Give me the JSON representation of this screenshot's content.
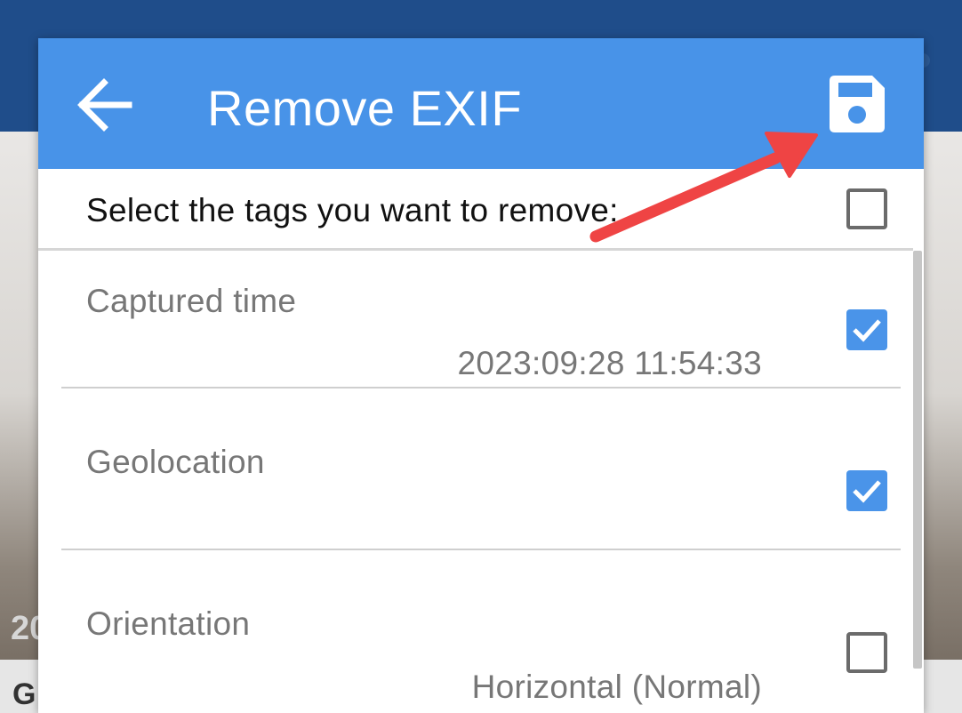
{
  "background": {
    "year_fragment": "20",
    "footer_fragment": "G"
  },
  "toolbar": {
    "title": "Remove EXIF",
    "back_icon": "arrow-left-icon",
    "save_icon": "floppy-disk-icon"
  },
  "select_all": {
    "label": "Select the tags you want to remove:",
    "checked": false
  },
  "tags": [
    {
      "name": "Captured time",
      "value": "2023:09:28 11:54:33",
      "checked": true
    },
    {
      "name": "Geolocation",
      "value": "",
      "checked": true
    },
    {
      "name": "Orientation",
      "value": "Horizontal (Normal)",
      "checked": false
    }
  ],
  "colors": {
    "toolbar": "#4893e8",
    "checkbox_checked": "#4a94e9",
    "annotation_arrow": "#ef4444"
  }
}
